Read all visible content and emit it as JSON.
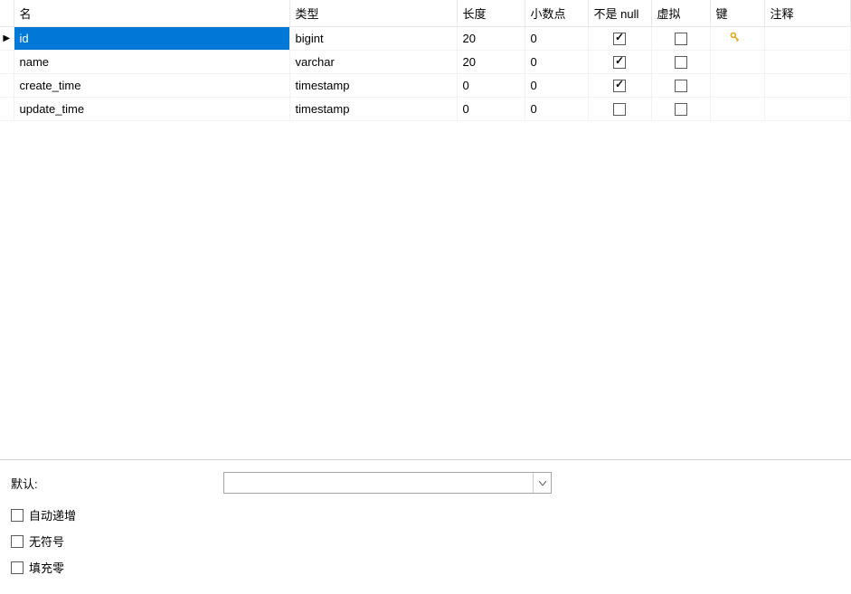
{
  "table": {
    "headers": {
      "name": "名",
      "type": "类型",
      "length": "长度",
      "decimal": "小数点",
      "notnull": "不是 null",
      "virtual": "虚拟",
      "key": "键",
      "comment": "注释"
    },
    "rows": [
      {
        "selected": true,
        "name": "id",
        "type": "bigint",
        "length": "20",
        "decimal": "0",
        "notnull": true,
        "virtual": false,
        "key": "1",
        "comment": ""
      },
      {
        "selected": false,
        "name": "name",
        "type": "varchar",
        "length": "20",
        "decimal": "0",
        "notnull": true,
        "virtual": false,
        "key": "",
        "comment": ""
      },
      {
        "selected": false,
        "name": "create_time",
        "type": "timestamp",
        "length": "0",
        "decimal": "0",
        "notnull": true,
        "virtual": false,
        "key": "",
        "comment": ""
      },
      {
        "selected": false,
        "name": "update_time",
        "type": "timestamp",
        "length": "0",
        "decimal": "0",
        "notnull": false,
        "virtual": false,
        "key": "",
        "comment": ""
      }
    ]
  },
  "bottom": {
    "default_label": "默认:",
    "default_value": "",
    "auto_increment_label": "自动递增",
    "auto_increment": false,
    "unsigned_label": "无符号",
    "unsigned": false,
    "zerofill_label": "填充零",
    "zerofill": false
  }
}
